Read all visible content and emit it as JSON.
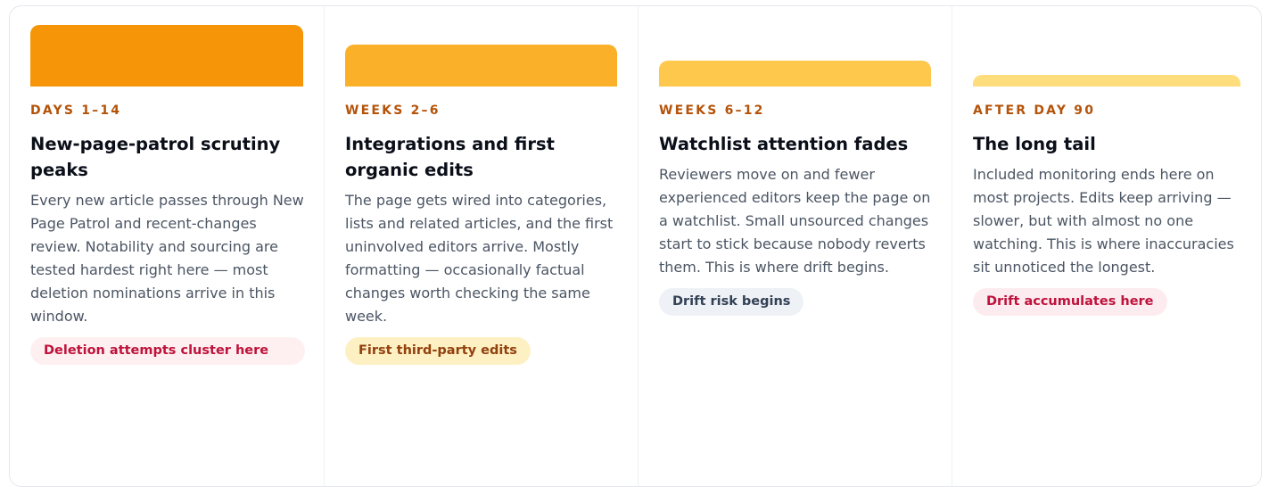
{
  "stages": [
    {
      "phase": "DAYS 1–14",
      "title": "New-page-patrol scrutiny peaks",
      "description": "Every new article passes through New Page Patrol and recent-changes review. Notability and sourcing are tested hardest right here — most deletion nominations arrive in this window.",
      "tag": "Deletion attempts cluster here",
      "bar_color": "#f59507",
      "tag_bg": "#fef0f0",
      "tag_color": "#be123c"
    },
    {
      "phase": "WEEKS 2–6",
      "title": "Integrations and first organic edits",
      "description": "The page gets wired into categories, lists and related articles, and the first uninvolved editors arrive. Mostly formatting — occasionally factual changes worth checking the same week.",
      "tag": "First third-party edits",
      "bar_color": "#fbb02a",
      "tag_bg": "#fdf0c2",
      "tag_color": "#92400e"
    },
    {
      "phase": "WEEKS 6–12",
      "title": "Watchlist attention fades",
      "description": "Reviewers move on and fewer experienced editors keep the page on a watchlist. Small unsourced changes start to stick because nobody reverts them. This is where drift begins.",
      "tag": "Drift risk begins",
      "bar_color": "#fdc84b",
      "tag_bg": "#eef1f6",
      "tag_color": "#334155"
    },
    {
      "phase": "AFTER DAY 90",
      "title": "The long tail",
      "description": "Included monitoring ends here on most projects. Edits keep arriving — slower, but with almost no one watching. This is where inaccuracies sit unnoticed the longest.",
      "tag": "Drift accumulates here",
      "bar_color": "#fedd7d",
      "tag_bg": "#fdecef",
      "tag_color": "#be123c"
    }
  ]
}
